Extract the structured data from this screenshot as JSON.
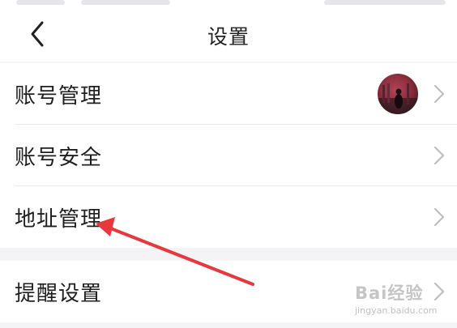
{
  "header": {
    "title": "设置"
  },
  "groups": [
    {
      "items": [
        {
          "label": "账号管理",
          "has_avatar": true
        },
        {
          "label": "账号安全"
        },
        {
          "label": "地址管理"
        }
      ]
    },
    {
      "items": [
        {
          "label": "提醒设置"
        }
      ]
    }
  ],
  "icons": {
    "back": "chevron-left-icon",
    "row_chevron": "chevron-right-icon"
  },
  "annotation": {
    "type": "arrow",
    "target": "地址管理",
    "color": "#e8383d"
  },
  "watermark": {
    "brand": "Bai经验",
    "url": "jingyan.baidu.com"
  },
  "colors": {
    "page_background": "#f4f4f6",
    "surface": "#ffffff",
    "text": "#1f1f1f",
    "divider": "#ececec",
    "chevron": "#bfbfbf",
    "annotation": "#e8383d"
  }
}
